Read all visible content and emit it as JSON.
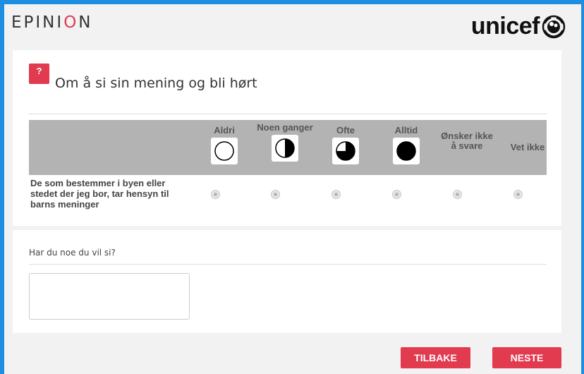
{
  "header": {
    "brand_before": "EPINI",
    "brand_accent": "O",
    "brand_after": "N",
    "partner_logo_text": "unicef"
  },
  "question": {
    "badge": "?",
    "title": "Om å si sin mening og bli hørt",
    "row_label": "De som bestemmer i byen eller stedet der jeg bor, tar hensyn til barns meninger",
    "columns": [
      {
        "label": "Aldri",
        "icon": "empty-circle-icon"
      },
      {
        "label": "Noen ganger",
        "icon": "half-circle-icon"
      },
      {
        "label": "Ofte",
        "icon": "three-quarter-circle-icon"
      },
      {
        "label": "Alltid",
        "icon": "full-circle-icon"
      },
      {
        "label": "Ønsker ikke å svare",
        "icon": ""
      },
      {
        "label": "Vet ikke",
        "icon": ""
      }
    ]
  },
  "comment": {
    "label": "Har du noe du vil si?",
    "value": ""
  },
  "buttons": {
    "back": "TILBAKE",
    "next": "NESTE"
  },
  "colors": {
    "accent": "#e23a4f",
    "frame": "#1e8fe0",
    "grid_header": "#b3b3b3"
  }
}
